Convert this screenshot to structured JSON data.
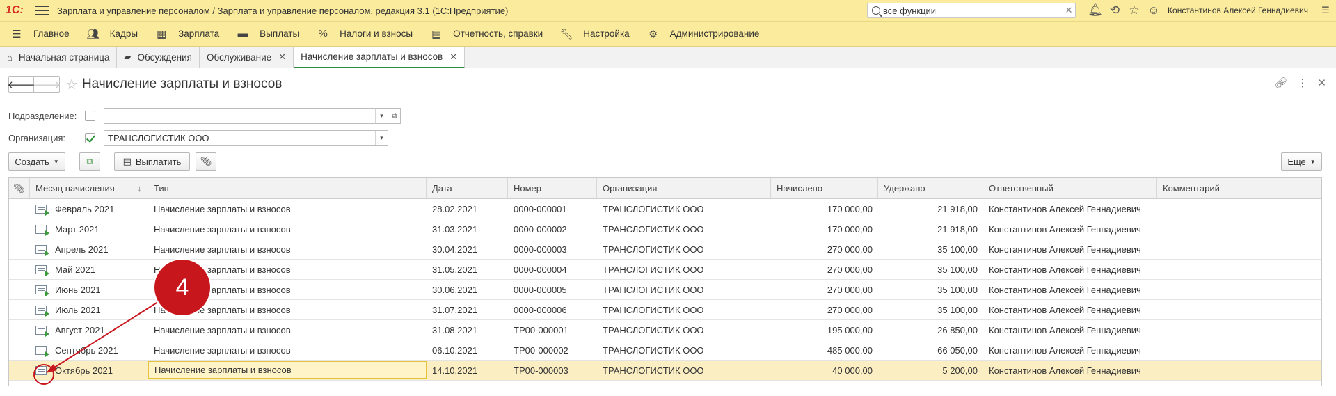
{
  "app": {
    "logo": "1С:",
    "title": "Зарплата и управление персоналом / Зарплата и управление персоналом, редакция 3.1  (1С:Предприятие)",
    "search_value": "все функции",
    "user": "Константинов Алексей Геннадиевич"
  },
  "sections": [
    {
      "label": "Главное",
      "icon": "menu-icon"
    },
    {
      "label": "Кадры",
      "icon": "people-icon"
    },
    {
      "label": "Зарплата",
      "icon": "calculator-icon"
    },
    {
      "label": "Выплаты",
      "icon": "wallet-icon"
    },
    {
      "label": "Налоги и взносы",
      "icon": "percent-icon"
    },
    {
      "label": "Отчетность, справки",
      "icon": "reports-icon"
    },
    {
      "label": "Настройка",
      "icon": "wrench-icon"
    },
    {
      "label": "Администрирование",
      "icon": "gear-icon"
    }
  ],
  "tabs": [
    {
      "label": "Начальная страница",
      "icon": "home-icon"
    },
    {
      "label": "Обсуждения",
      "icon": "chat-icon"
    },
    {
      "label": "Обслуживание",
      "closable": true
    },
    {
      "label": "Начисление зарплаты и взносов",
      "closable": true,
      "active": true
    }
  ],
  "form": {
    "title": "Начисление зарплаты и взносов",
    "filters": {
      "department_label": "Подразделение:",
      "department_value": "",
      "organization_label": "Организация:",
      "organization_value": "ТРАНСЛОГИСТИК ООО"
    },
    "buttons": {
      "create": "Создать",
      "pay": "Выплатить",
      "more": "Еще"
    }
  },
  "table": {
    "columns": [
      "Месяц начисления",
      "Тип",
      "Дата",
      "Номер",
      "Организация",
      "Начислено",
      "Удержано",
      "Ответственный",
      "Комментарий"
    ],
    "rows": [
      [
        "Февраль 2021",
        "Начисление зарплаты и взносов",
        "28.02.2021",
        "0000-000001",
        "ТРАНСЛОГИСТИК ООО",
        "170 000,00",
        "21 918,00",
        "Константинов Алексей Геннадиевич",
        ""
      ],
      [
        "Март 2021",
        "Начисление зарплаты и взносов",
        "31.03.2021",
        "0000-000002",
        "ТРАНСЛОГИСТИК ООО",
        "170 000,00",
        "21 918,00",
        "Константинов Алексей Геннадиевич",
        ""
      ],
      [
        "Апрель 2021",
        "Начисление зарплаты и взносов",
        "30.04.2021",
        "0000-000003",
        "ТРАНСЛОГИСТИК ООО",
        "270 000,00",
        "35 100,00",
        "Константинов Алексей Геннадиевич",
        ""
      ],
      [
        "Май 2021",
        "Начисление зарплаты и взносов",
        "31.05.2021",
        "0000-000004",
        "ТРАНСЛОГИСТИК ООО",
        "270 000,00",
        "35 100,00",
        "Константинов Алексей Геннадиевич",
        ""
      ],
      [
        "Июнь 2021",
        "Начисление зарплаты и взносов",
        "30.06.2021",
        "0000-000005",
        "ТРАНСЛОГИСТИК ООО",
        "270 000,00",
        "35 100,00",
        "Константинов Алексей Геннадиевич",
        ""
      ],
      [
        "Июль 2021",
        "Начисление зарплаты и взносов",
        "31.07.2021",
        "0000-000006",
        "ТРАНСЛОГИСТИК ООО",
        "270 000,00",
        "35 100,00",
        "Константинов Алексей Геннадиевич",
        ""
      ],
      [
        "Август 2021",
        "Начисление зарплаты и взносов",
        "31.08.2021",
        "ТР00-000001",
        "ТРАНСЛОГИСТИК ООО",
        "195 000,00",
        "26 850,00",
        "Константинов Алексей Геннадиевич",
        ""
      ],
      [
        "Сентябрь 2021",
        "Начисление зарплаты и взносов",
        "06.10.2021",
        "ТР00-000002",
        "ТРАНСЛОГИСТИК ООО",
        "485 000,00",
        "66 050,00",
        "Константинов Алексей Геннадиевич",
        ""
      ],
      [
        "Октябрь 2021",
        "Начисление зарплаты и взносов",
        "14.10.2021",
        "ТР00-000003",
        "ТРАНСЛОГИСТИК ООО",
        "40 000,00",
        "5 200,00",
        "Константинов Алексей Геннадиевич",
        ""
      ]
    ],
    "posted": [
      true,
      true,
      true,
      true,
      true,
      true,
      true,
      true,
      false
    ],
    "selected_row": 8
  },
  "annotation": {
    "number": "4"
  },
  "colors": {
    "header_bg": "#fbeb9c",
    "callout": "#c8161d",
    "selection": "#fbeec3",
    "accent": "#2b8a3e"
  }
}
